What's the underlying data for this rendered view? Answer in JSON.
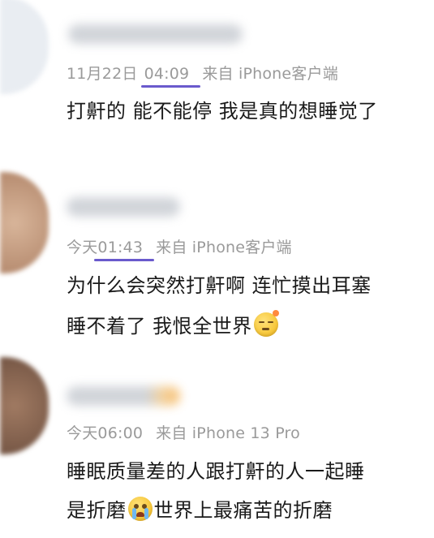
{
  "colors": {
    "meta_text": "#9a9a9a",
    "body_text": "#1a1a1a",
    "underline": "#6a5acd"
  },
  "comments": [
    {
      "date": "11月22日",
      "time": "04:09",
      "source": "来自 iPhone客户端",
      "lines": [
        "打鼾的 能不能停 我是真的想睡觉了"
      ],
      "avatar_color": "#e9edf2"
    },
    {
      "date": "今天",
      "time": "01:43",
      "source": "来自 iPhone客户端",
      "lines": [
        "为什么会突然打鼾啊 连忙摸出耳塞",
        "睡不着了 我恨全世界"
      ],
      "emoji": "sleepy-face-icon",
      "avatar_color": "#c89a7a"
    },
    {
      "date": "今天",
      "time": "06:00",
      "source": "来自 iPhone 13 Pro",
      "lines": [
        "睡眠质量差的人跟打鼾的人一起睡",
        "是折磨",
        "世界上最痛苦的折磨"
      ],
      "emoji": "crying-face-icon",
      "avatar_color": "#8a6a55"
    }
  ]
}
